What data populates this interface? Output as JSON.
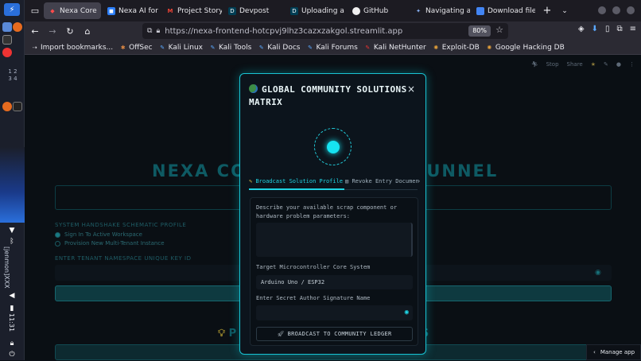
{
  "tabs": [
    {
      "label": "Nexa Core",
      "active": true,
      "icon": "streamlit-icon"
    },
    {
      "label": "Nexa AI for Re",
      "icon": "nexa-icon"
    },
    {
      "label": "Project Story",
      "icon": "gmail-icon"
    },
    {
      "label": "Devpost",
      "icon": "devpost-icon"
    },
    {
      "label": "Uploading a d",
      "icon": "devpost-icon"
    },
    {
      "label": "GitHub",
      "icon": "github-icon"
    },
    {
      "label": "Navigating a",
      "icon": "gemini-icon"
    },
    {
      "label": "Download file",
      "icon": "docs-icon"
    }
  ],
  "navbar": {
    "url": "https://nexa-frontend-hotcpvj9lhz3cazxzakgol.streamlit.app",
    "zoom": "80%"
  },
  "bookmarks": [
    "Import bookmarks...",
    "OffSec",
    "Kali Linux",
    "Kali Tools",
    "Kali Docs",
    "Kali Forums",
    "Kali NetHunter",
    "Exploit-DB",
    "Google Hacking DB"
  ],
  "dock": {
    "workspaces": [
      "1",
      "2",
      "3",
      "4"
    ],
    "user": "[jenmon]XXX",
    "clock": "11:31"
  },
  "streamlit_bar": {
    "stop": "Stop",
    "share": "Share"
  },
  "background": {
    "title_left": "NEXA CO",
    "title_right": "TUNNEL",
    "schematic_label": "SYSTEM HANDSHAKE SCHEMATIC PROFILE",
    "radio_signin": "Sign In To Active Workspace",
    "radio_provision": "Provision New Multi-Tenant Instance",
    "key_label": "ENTER TENANT NAMESPACE UNIQUE KEY ID",
    "subtitle_left": "P",
    "subtitle_right": "TS"
  },
  "manage_app": "Manage app",
  "modal": {
    "title": "GLOBAL COMMUNITY SOLUTIONS MATRIX",
    "close": "×",
    "tab_broadcast": "Broadcast Solution Profile",
    "tab_revoke": "Revoke Entry Documen",
    "describe_label": "Describe your available scrap component or hardware problem parameters:",
    "target_label": "Target Microcontroller Core System",
    "target_value": "Arduino Uno / ESP32",
    "signature_label": "Enter Secret Author Signature Name",
    "broadcast_button": "BROADCAST TO COMMUNITY LEDGER"
  }
}
